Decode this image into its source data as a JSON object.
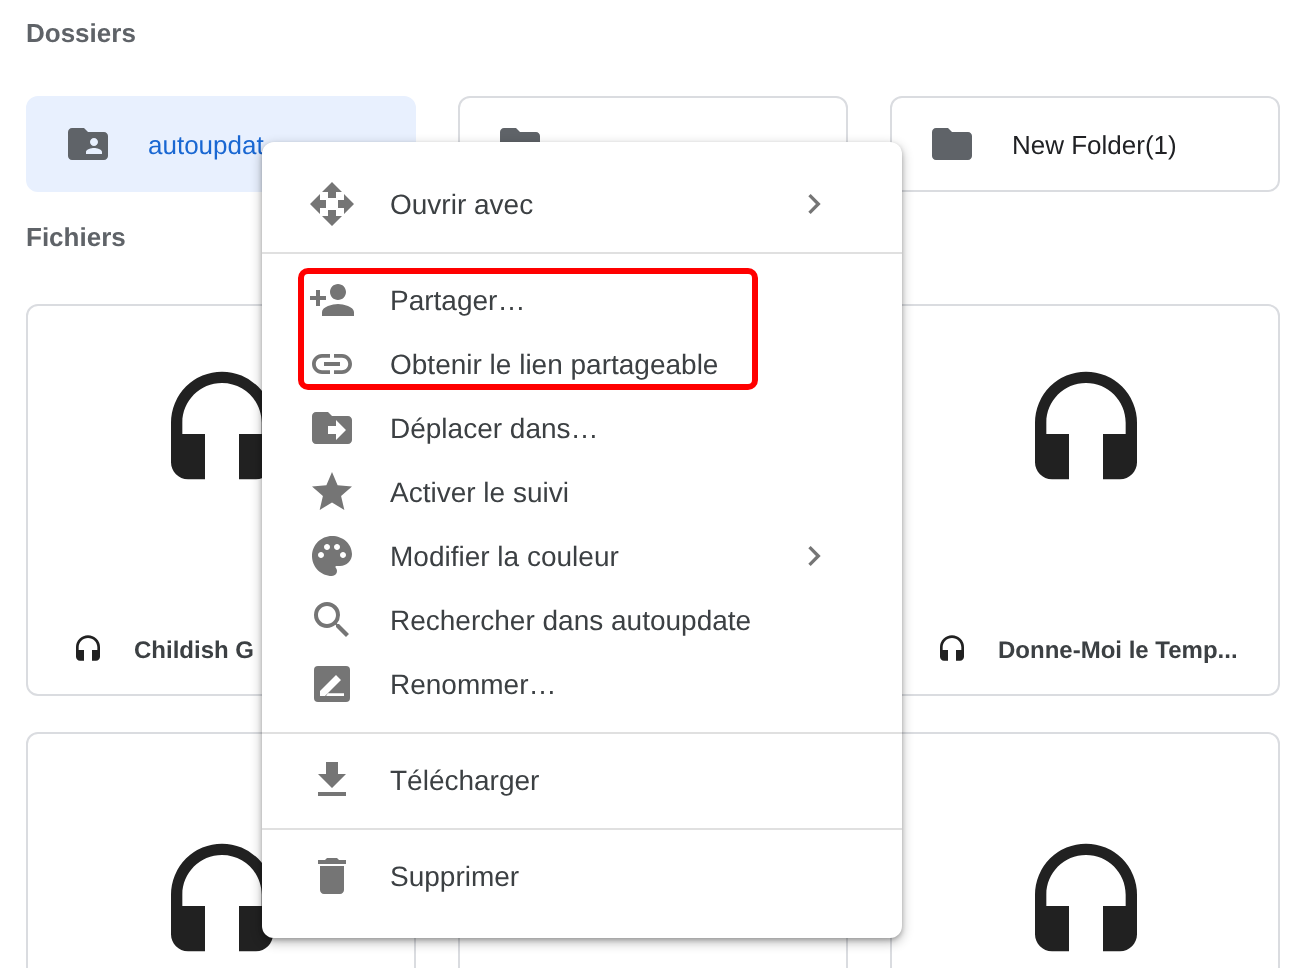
{
  "folders_heading": "Dossiers",
  "folders": [
    {
      "name": "autoupdat",
      "kind": "shared",
      "selected": true
    },
    {
      "kind": "plain",
      "selected": false
    },
    {
      "name": "New Folder(1)",
      "kind": "plain",
      "selected": false
    }
  ],
  "files_heading": "Fichiers",
  "files": [
    {
      "kind": "file",
      "name": "Childish G",
      "covered": false
    },
    {
      "kind": "empty"
    },
    {
      "kind": "file",
      "name": "Donne-Moi le Temp...",
      "covered": false
    },
    {
      "kind": "file",
      "covered": false
    },
    {
      "kind": "file",
      "covered": true
    },
    {
      "kind": "file",
      "covered": false
    }
  ],
  "context_menu": {
    "sections": [
      {
        "groups": [
          {
            "highlighted": false,
            "items": [
              {
                "label": "Ouvrir avec",
                "kind": "open-with",
                "submenu": true
              }
            ]
          }
        ]
      },
      {
        "groups": [
          {
            "highlighted": true,
            "items": [
              {
                "label": "Partager…",
                "kind": "share",
                "submenu": false
              },
              {
                "label": "Obtenir le lien partageable",
                "kind": "link",
                "submenu": false
              }
            ]
          },
          {
            "highlighted": false,
            "items": [
              {
                "label": "Déplacer dans…",
                "kind": "move",
                "submenu": false
              },
              {
                "label": "Activer le suivi",
                "kind": "star",
                "submenu": false
              },
              {
                "label": "Modifier la couleur",
                "kind": "color",
                "submenu": true
              },
              {
                "label": "Rechercher dans autoupdate",
                "kind": "search",
                "submenu": false
              },
              {
                "label": "Renommer…",
                "kind": "rename",
                "submenu": false
              }
            ]
          }
        ]
      },
      {
        "groups": [
          {
            "highlighted": false,
            "items": [
              {
                "label": "Télécharger",
                "kind": "download",
                "submenu": false
              }
            ]
          }
        ]
      },
      {
        "groups": [
          {
            "highlighted": false,
            "items": [
              {
                "label": "Supprimer",
                "kind": "delete",
                "submenu": false
              }
            ]
          }
        ]
      }
    ]
  }
}
